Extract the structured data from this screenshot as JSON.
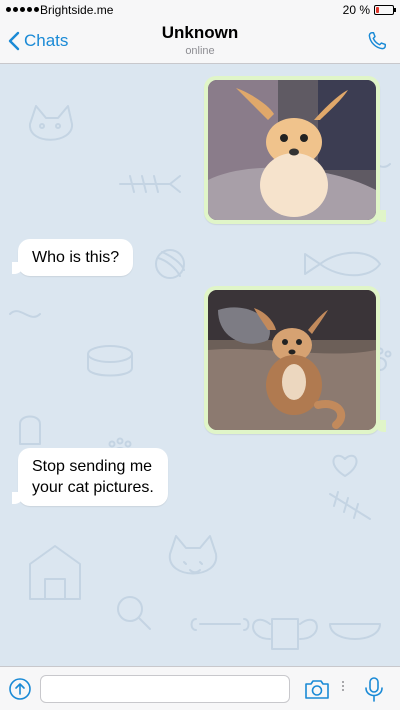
{
  "status_bar": {
    "carrier": "Brightside.me",
    "battery_percent": "20 %",
    "battery_level": 0.2,
    "signal_bars": 5,
    "battery_color": "#e0362b"
  },
  "nav": {
    "back_label": "Chats",
    "contact_name": "Unknown",
    "contact_status": "online",
    "back_icon": "chevron-left-icon",
    "call_icon": "phone-icon",
    "accent": "#1a8ad6"
  },
  "messages": [
    {
      "side": "outgoing",
      "type": "photo",
      "subject": "chihuahua-on-couch"
    },
    {
      "side": "incoming",
      "type": "text",
      "text": "Who is this?"
    },
    {
      "side": "outgoing",
      "type": "photo",
      "subject": "chihuahua-on-carpet"
    },
    {
      "side": "incoming",
      "type": "text",
      "text_line1": "Stop sending me",
      "text_line2": "your cat pictures."
    }
  ],
  "colors": {
    "outgoing_bubble": "#e0f5c8",
    "incoming_bubble": "#ffffff",
    "chat_background": "#dbe6f0"
  },
  "input_bar": {
    "message_value": "",
    "attach_icon": "attach-icon",
    "camera_icon": "camera-icon",
    "mic_icon": "microphone-icon"
  }
}
